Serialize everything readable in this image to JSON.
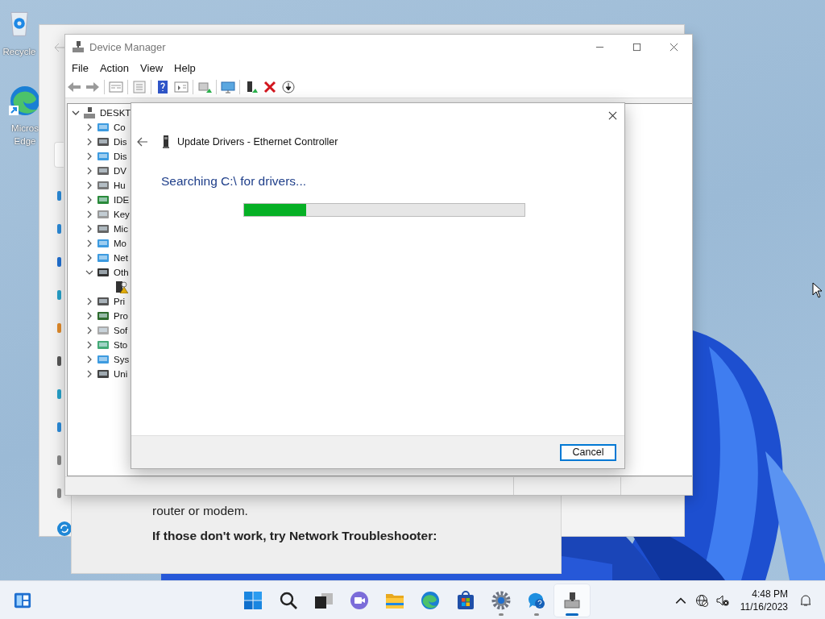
{
  "desktop_icons": [
    {
      "lines": [
        "Recycle"
      ]
    },
    {
      "lines": [
        "Micros",
        "Edge"
      ]
    }
  ],
  "help_window": {
    "paragraph": "router or modem.",
    "heading": "If those don't work, try Network Troubleshooter:"
  },
  "device_manager": {
    "title": "Device Manager",
    "menu": [
      "File",
      "Action",
      "View",
      "Help"
    ],
    "tree": {
      "label": "DESKT",
      "expanded": true,
      "children": [
        {
          "label": "Co",
          "expanded": false
        },
        {
          "label": "Dis",
          "expanded": false
        },
        {
          "label": "Dis",
          "expanded": false
        },
        {
          "label": "DV",
          "expanded": false
        },
        {
          "label": "Hu",
          "expanded": false
        },
        {
          "label": "IDE",
          "expanded": false
        },
        {
          "label": "Key",
          "expanded": false
        },
        {
          "label": "Mic",
          "expanded": false
        },
        {
          "label": "Mo",
          "expanded": false
        },
        {
          "label": "Net",
          "expanded": false
        },
        {
          "label": "Oth",
          "expanded": true,
          "children": [
            {
              "warning": true
            }
          ]
        },
        {
          "label": "Pri",
          "expanded": false
        },
        {
          "label": "Pro",
          "expanded": false
        },
        {
          "label": "Sof",
          "expanded": false
        },
        {
          "label": "Sto",
          "expanded": false
        },
        {
          "label": "Sys",
          "expanded": false
        },
        {
          "label": "Uni",
          "expanded": false
        }
      ]
    }
  },
  "dialog": {
    "title": "Update Drivers - Ethernet Controller",
    "status": "Searching C:\\ for drivers...",
    "progress": {
      "level": 0.22
    },
    "button": "Cancel"
  },
  "taskbar": {
    "apps": [
      {
        "kind": "start",
        "active": false,
        "running": false
      },
      {
        "kind": "search",
        "active": false,
        "running": false
      },
      {
        "kind": "taskview",
        "active": false,
        "running": false
      },
      {
        "kind": "chat",
        "active": false,
        "running": false
      },
      {
        "kind": "folder",
        "active": false,
        "running": false
      },
      {
        "kind": "edge",
        "active": false,
        "running": false
      },
      {
        "kind": "store",
        "active": false,
        "running": false
      },
      {
        "kind": "settings",
        "active": false,
        "running": true
      },
      {
        "kind": "help",
        "active": false,
        "running": true
      },
      {
        "kind": "devmgr",
        "active": true,
        "running": true
      }
    ],
    "time": "4:48 PM",
    "date": "11/16/2023"
  }
}
